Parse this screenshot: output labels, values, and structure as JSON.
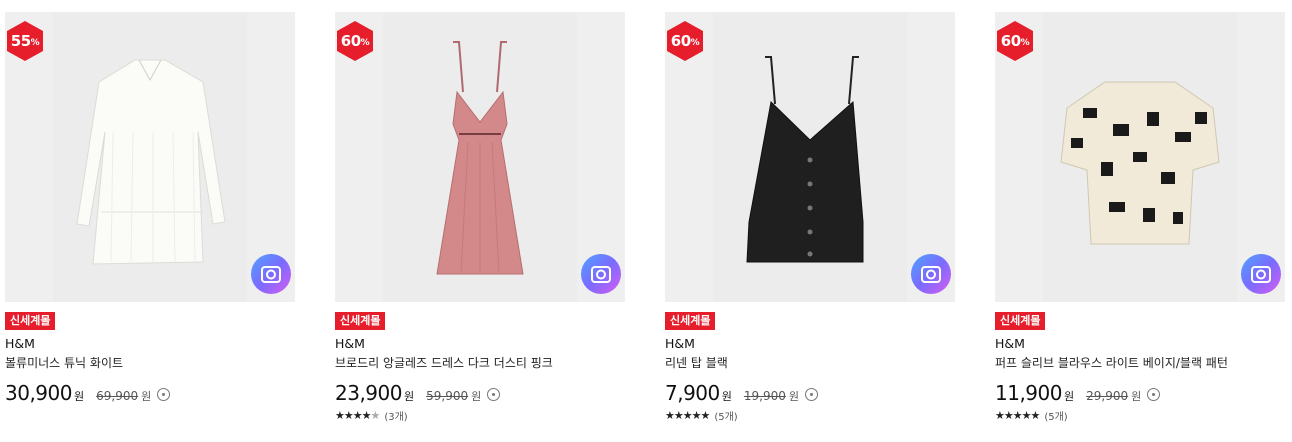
{
  "products": [
    {
      "discount": "55",
      "discount_unit": "%",
      "tag": "신세계몰",
      "brand": "H&M",
      "name": "볼류미너스 튜닉 화이트",
      "price": "30,900",
      "currency": "원",
      "original_price": "69,900",
      "original_currency": "원",
      "rating": null,
      "review_count": null,
      "image": "white-tunic-dress"
    },
    {
      "discount": "60",
      "discount_unit": "%",
      "tag": "신세계몰",
      "brand": "H&M",
      "name": "브로드리 앙글레즈 드레스 다크 더스티 핑크",
      "price": "23,900",
      "currency": "원",
      "original_price": "59,900",
      "original_currency": "원",
      "rating": 4.5,
      "review_count": "(3개)",
      "image": "pink-eyelet-dress"
    },
    {
      "discount": "60",
      "discount_unit": "%",
      "tag": "신세계몰",
      "brand": "H&M",
      "name": "리넨 탑 블랙",
      "price": "7,900",
      "currency": "원",
      "original_price": "19,900",
      "original_currency": "원",
      "rating": 5,
      "review_count": "(5개)",
      "image": "black-linen-camisole"
    },
    {
      "discount": "60",
      "discount_unit": "%",
      "tag": "신세계몰",
      "brand": "H&M",
      "name": "퍼프 슬리브 블라우스 라이트 베이지/블랙 패턴",
      "price": "11,900",
      "currency": "원",
      "original_price": "29,900",
      "original_currency": "원",
      "rating": 5,
      "review_count": "(5개)",
      "image": "puff-sleeve-blouse"
    }
  ],
  "colors": {
    "badge_red": "#e61e2b",
    "tag_red": "#e61e2b",
    "camera_gradient": [
      "#4fa3ff",
      "#7a6bff",
      "#d85df0"
    ]
  },
  "icons": {
    "badge": "hexagon-discount-badge",
    "camera": "camera-icon",
    "info": "info-icon",
    "star": "star-icon"
  }
}
